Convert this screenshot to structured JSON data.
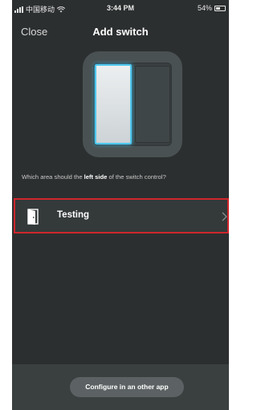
{
  "status_bar": {
    "carrier": "中国移动",
    "time": "3:44 PM",
    "battery_percent_label": "54%",
    "battery_level": 0.54,
    "icons": [
      "signal-icon",
      "wifi-icon",
      "battery-icon"
    ]
  },
  "nav": {
    "close_label": "Close",
    "title": "Add switch"
  },
  "switch_illustration": {
    "highlighted_side": "left",
    "highlight_color": "#4fc8ef"
  },
  "question": {
    "prefix": "Which area should the ",
    "emphasis": "left side",
    "suffix": " of the switch control?"
  },
  "room": {
    "label": "Testing",
    "icon": "door-icon",
    "selected_border_color": "#d0262c"
  },
  "bottom": {
    "configure_label": "Configure in an other app"
  }
}
